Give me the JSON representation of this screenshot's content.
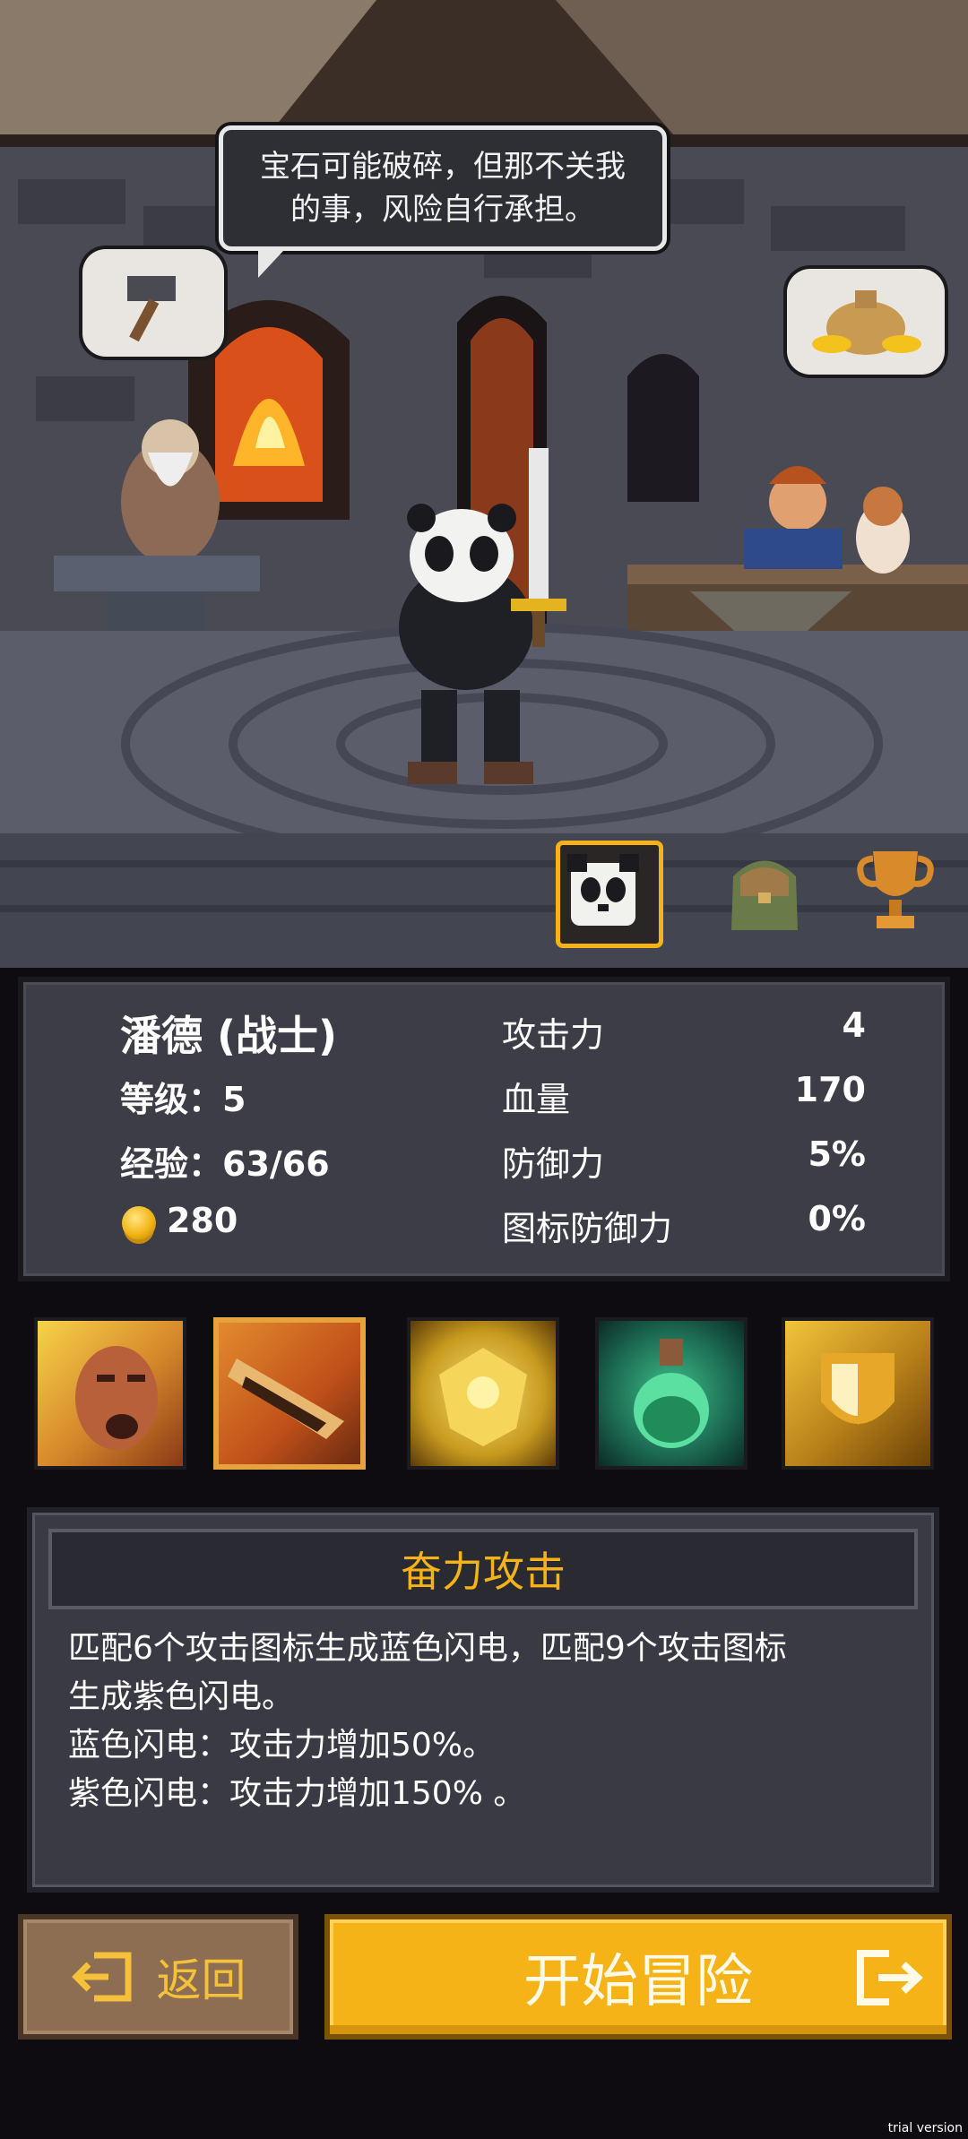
{
  "scene": {
    "speech": "宝石可能破碎，但那不关我的事，风险自行承担。",
    "blacksmith_bubble_icon": "hammer-icon",
    "merchant_bubble_icon": "money-bag-icon",
    "tabs": [
      {
        "name": "hero",
        "icon": "panda-face-icon",
        "active": true
      },
      {
        "name": "inventory",
        "icon": "backpack-icon",
        "active": false
      },
      {
        "name": "trophies",
        "icon": "trophy-icon",
        "active": false
      }
    ]
  },
  "stats": {
    "name": "潘德 (战士)",
    "level_label": "等级：5",
    "exp_label": "经验：63/66",
    "gold": "280",
    "attack_label": "攻击力",
    "attack_value": "4",
    "hp_label": "血量",
    "hp_value": "170",
    "defense_label": "防御力",
    "defense_value": "5%",
    "icon_defense_label": "图标防御力",
    "icon_defense_value": "0%"
  },
  "skills": [
    {
      "icon": "roar-icon",
      "selected": false
    },
    {
      "icon": "power-strike-icon",
      "selected": true
    },
    {
      "icon": "golden-armor-icon",
      "selected": false
    },
    {
      "icon": "potion-icon",
      "selected": false
    },
    {
      "icon": "shield-icon",
      "selected": false
    }
  ],
  "description": {
    "title": "奋力攻击",
    "lines": [
      "匹配6个攻击图标生成蓝色闪电，匹配9个攻击图标",
      "生成紫色闪电。",
      "蓝色闪电：攻击力增加50%。",
      "紫色闪电：攻击力增加150% 。"
    ]
  },
  "buttons": {
    "back": "返回",
    "start": "开始冒险"
  },
  "watermark": "trial version",
  "colors": {
    "accent": "#f5b318",
    "panel": "#3c3d47",
    "back_button": "#8d6e52"
  }
}
